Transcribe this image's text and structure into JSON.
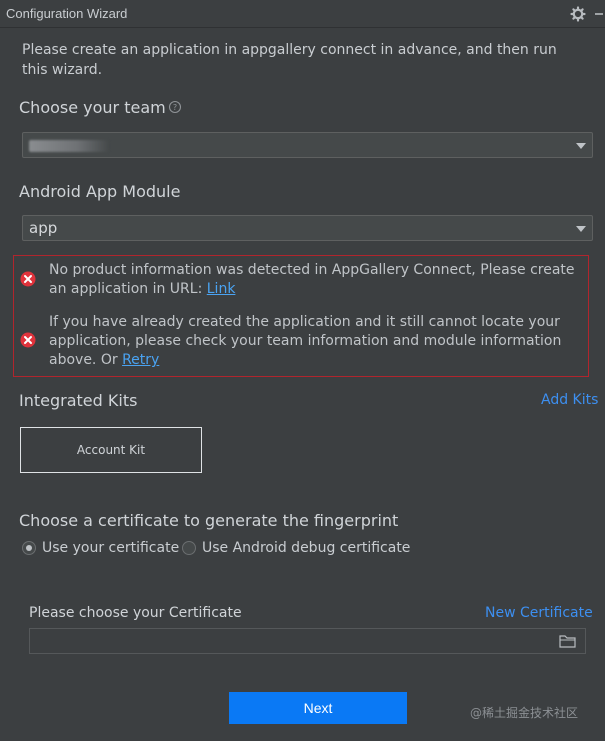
{
  "window": {
    "title": "Configuration Wizard"
  },
  "intro_text": "Please create an application in appgallery connect in advance, and then run this wizard.",
  "team": {
    "label": "Choose your team",
    "value": ""
  },
  "module": {
    "label": "Android App Module",
    "value": "app"
  },
  "errors": {
    "first": {
      "text": "No product information was detected in AppGallery Connect, Please create an application in URL:",
      "link": "Link"
    },
    "second": {
      "text": "If you have already created the application and it still cannot locate your application, please check your team information and module information above. Or",
      "link": "Retry"
    }
  },
  "kits": {
    "label": "Integrated Kits",
    "add_link": "Add Kits",
    "items": [
      "Account Kit"
    ]
  },
  "certificate": {
    "heading": "Choose a certificate to generate the fingerprint",
    "option_own": "Use your certificate",
    "option_debug": "Use Android debug certificate",
    "selected": "Use your certificate",
    "field_label": "Please choose your Certificate",
    "new_link": "New Certificate",
    "path_value": ""
  },
  "next_button": "Next",
  "watermark": "@稀土掘金技术社区",
  "colors": {
    "background": "#3c3f41",
    "error_border": "#b1252d",
    "error_icon": "#e0333c",
    "link": "#3d8ff0",
    "primary_button": "#0a79f5"
  }
}
